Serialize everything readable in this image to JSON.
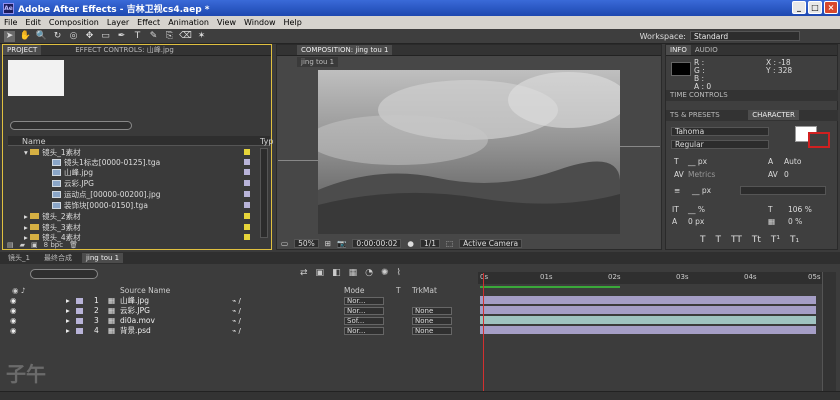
{
  "title_bar": {
    "title": "Adobe After Effects - 吉林卫视cs4.aep *",
    "app_icon": "Ae",
    "min": "_",
    "max": "□",
    "close": "×"
  },
  "menu": [
    "File",
    "Edit",
    "Composition",
    "Layer",
    "Effect",
    "Animation",
    "View",
    "Window",
    "Help"
  ],
  "workspace": {
    "label": "Workspace:",
    "value": "Standard"
  },
  "project_panel": {
    "tab_project": "PROJECT",
    "tab_effect_controls": "EFFECT CONTROLS: 山峰.jpg",
    "col_name": "Name",
    "col_type": "Typ",
    "items": [
      {
        "name": "镜头_1素材",
        "kind": "folder"
      },
      {
        "name": "镜头1标志[0000-0125].tga",
        "kind": "file"
      },
      {
        "name": "山峰.jpg",
        "kind": "file"
      },
      {
        "name": "云彩.JPG",
        "kind": "file"
      },
      {
        "name": "运动点_[00000-00200].jpg",
        "kind": "file"
      },
      {
        "name": "装饰块[0000-0150].tga",
        "kind": "file"
      },
      {
        "name": "镜头_2素材",
        "kind": "folder"
      },
      {
        "name": "镜头_3素材",
        "kind": "folder"
      },
      {
        "name": "镜头_4素材",
        "kind": "folder"
      }
    ],
    "footer_bpc": "8 bpc"
  },
  "comp_panel": {
    "tab": "COMPOSITION: jing tou 1",
    "subtab": "jing tou 1",
    "zoom": "50%",
    "timecode": "0:00:00:02",
    "resolution": "1/1",
    "camera": "Active Camera"
  },
  "right_panel": {
    "tab_info": "INFO",
    "tab_audio": "AUDIO",
    "info_r": "R :",
    "info_g": "G :",
    "info_b": "B :",
    "info_a": "A : 0",
    "info_x": "X : -18",
    "info_y": "Y : 328",
    "tab_time_controls": "TIME CONTROLS",
    "tab_presets": "TS & PRESETS",
    "tab_character": "CHARACTER",
    "font": "Tahoma",
    "style": "Regular",
    "size": "__ px",
    "leading": "Auto",
    "kerning": "Metrics",
    "tracking": "0",
    "stroke_px": "__ px",
    "vscale": "__ %",
    "hscale": "106 %",
    "baseline": "0 px",
    "tsume": "0 %"
  },
  "timeline": {
    "tabs": [
      "镜头_1",
      "最终合成",
      "jing tou 1"
    ],
    "ruler_ticks": [
      "0s",
      "01s",
      "02s",
      "03s",
      "04s",
      "05s"
    ],
    "col_source": "Source Name",
    "col_mode": "Mode",
    "col_t": "T",
    "col_trkmat": "TrkMat",
    "layers": [
      {
        "num": "1",
        "name": "山峰.jpg",
        "mode": "Nor...",
        "trkmat": ""
      },
      {
        "num": "2",
        "name": "云彩.JPG",
        "mode": "Nor...",
        "trkmat": "None"
      },
      {
        "num": "3",
        "name": "di0a.mov",
        "mode": "Sof...",
        "trkmat": "None"
      },
      {
        "num": "4",
        "name": "背景.psd",
        "mode": "Nor...",
        "trkmat": "None"
      }
    ]
  },
  "watermark": "子午"
}
